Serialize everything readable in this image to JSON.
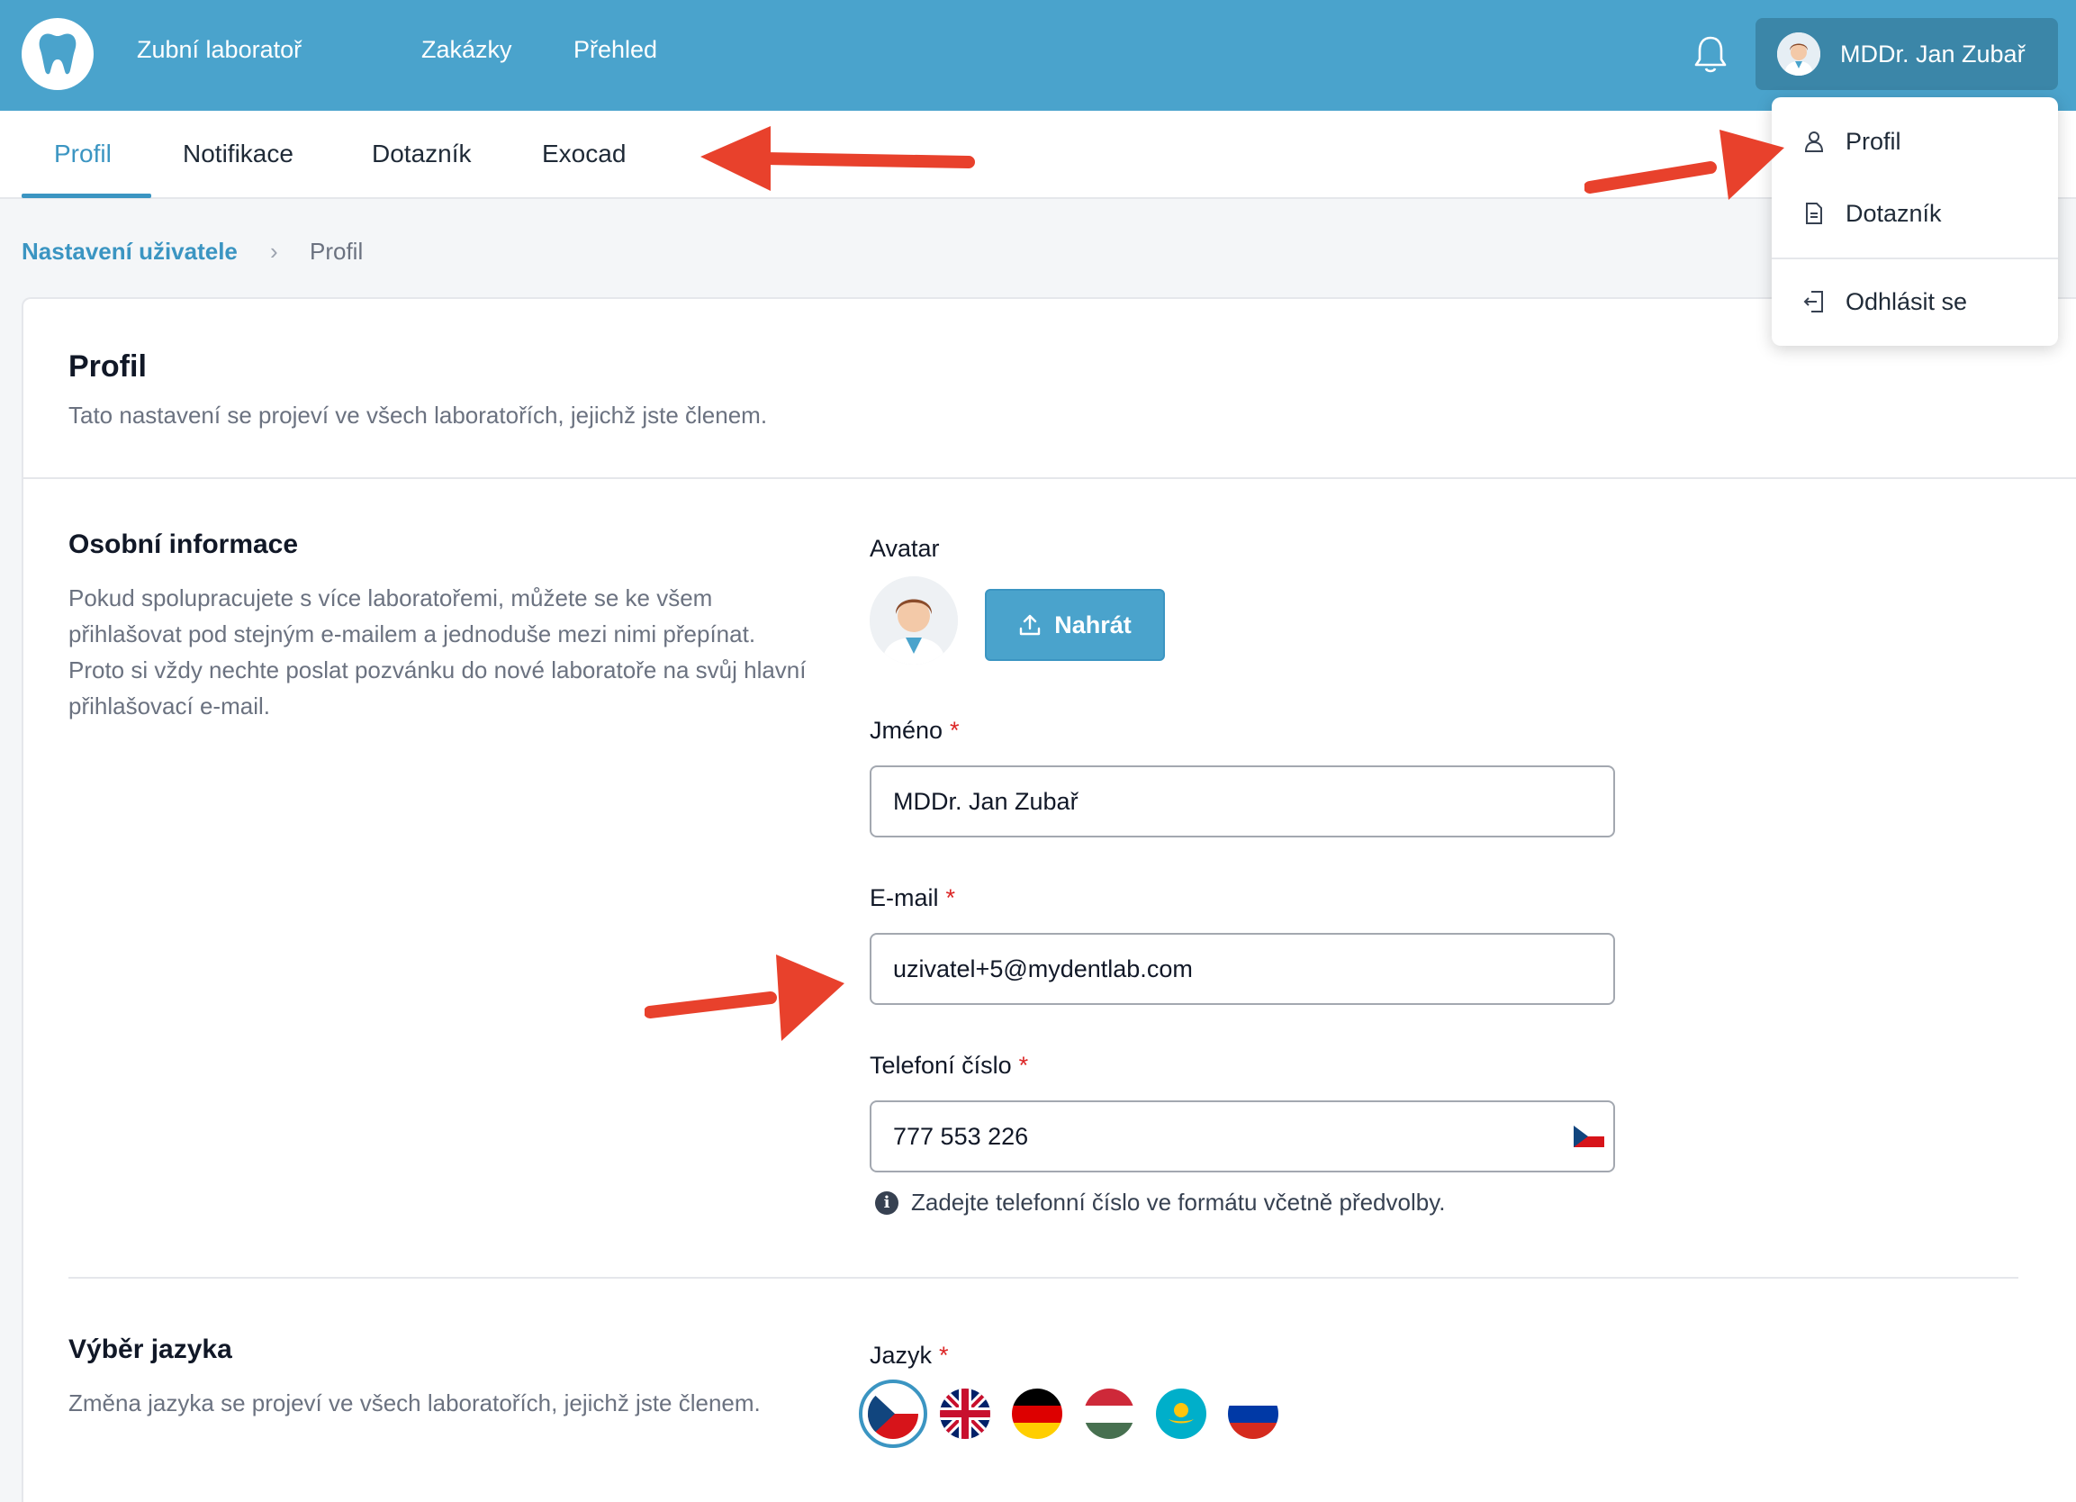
{
  "topbar": {
    "brand": "Zubní laboratoř",
    "nav": [
      "Zakázky",
      "Přehled"
    ],
    "user_name": "MDDr. Jan Zubař"
  },
  "tabs": [
    "Profil",
    "Notifikace",
    "Dotazník",
    "Exocad"
  ],
  "breadcrumb": {
    "parent": "Nastavení uživatele",
    "current": "Profil"
  },
  "card": {
    "title": "Profil",
    "subtitle": "Tato nastavení se projeví ve všech laboratořích, jejichž jste členem."
  },
  "personal": {
    "title": "Osobní informace",
    "description": "Pokud spolupracujete s více laboratořemi, můžete se ke všem přihlašovat pod stejným e-mailem a jednoduše mezi nimi přepínat. Proto si vždy nechte poslat pozvánku do nové laboratoře na svůj hlavní přihlašovací e-mail.",
    "avatar_label": "Avatar",
    "upload_label": "Nahrát",
    "name_label": "Jméno",
    "name_value": "MDDr. Jan Zubař",
    "email_label": "E-mail",
    "email_value": "uzivatel+5@mydentlab.com",
    "phone_label": "Telefoní číslo",
    "phone_value": "777 553 226",
    "phone_hint": "Zadejte telefonní číslo ve formátu včetně předvolby.",
    "required_mark": "*"
  },
  "language": {
    "title": "Výběr jazyka",
    "description": "Změna jazyka se projeví ve všech laboratořích, jejichž jste členem.",
    "label": "Jazyk",
    "flags": [
      "cz-flag-icon",
      "uk-flag-icon",
      "de-flag-icon",
      "hu-flag-icon",
      "kz-flag-icon",
      "ru-flag-icon"
    ],
    "selected": "cz-flag-icon"
  },
  "user_menu": {
    "items": [
      "Profil",
      "Dotazník",
      "Odhlásit se"
    ]
  },
  "colors": {
    "primary": "#4aa3cc",
    "accent_link": "#3b95c2",
    "annotation_arrow": "#e8412c"
  }
}
